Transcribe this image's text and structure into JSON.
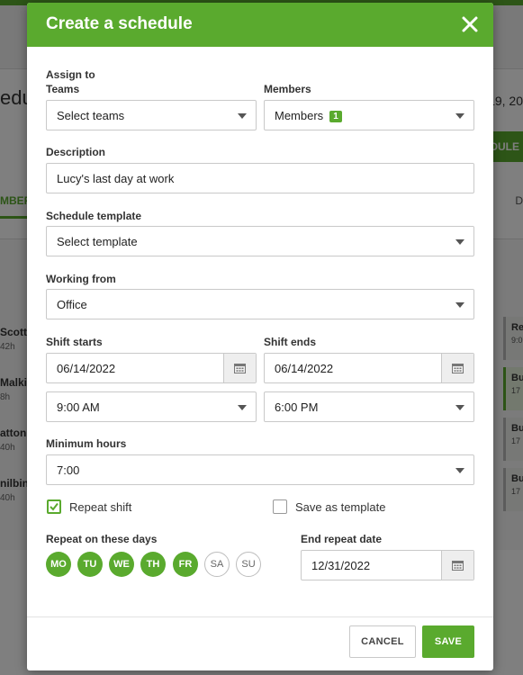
{
  "background": {
    "title_fragment": "edu",
    "date_fragment": "19, 20",
    "button_fragment": "DULE",
    "tab_fragment": "MBER",
    "tab2_fragment": "D",
    "people": [
      {
        "name": "Scott",
        "hours": "42h"
      },
      {
        "name": "Malkin",
        "hours": "8h"
      },
      {
        "name": "atton",
        "hours": "40h"
      },
      {
        "name": "nilbin",
        "hours": "40h"
      }
    ],
    "shifts": [
      {
        "label": "Re",
        "sub": "9:0"
      },
      {
        "label": "Bu",
        "sub": "17"
      },
      {
        "label": "Bu",
        "sub": "17"
      },
      {
        "label": "Bu",
        "sub": "17"
      }
    ]
  },
  "modal": {
    "title": "Create a schedule",
    "assign_to_label": "Assign to",
    "teams": {
      "label": "Teams",
      "value": "Select teams"
    },
    "members": {
      "label": "Members",
      "value": "Members",
      "count": "1"
    },
    "description": {
      "label": "Description",
      "value": "Lucy's last day at work"
    },
    "schedule_template": {
      "label": "Schedule template",
      "value": "Select template"
    },
    "working_from": {
      "label": "Working from",
      "value": "Office"
    },
    "shift_starts": {
      "label": "Shift starts",
      "date": "06/14/2022",
      "time": "9:00 AM"
    },
    "shift_ends": {
      "label": "Shift ends",
      "date": "06/14/2022",
      "time": "6:00 PM"
    },
    "minimum_hours": {
      "label": "Minimum hours",
      "value": "7:00"
    },
    "repeat_shift": {
      "label": "Repeat shift",
      "checked": true
    },
    "save_as_template": {
      "label": "Save as template",
      "checked": false
    },
    "repeat_days": {
      "label": "Repeat on these days",
      "days": [
        {
          "abbr": "MO",
          "selected": true
        },
        {
          "abbr": "TU",
          "selected": true
        },
        {
          "abbr": "WE",
          "selected": true
        },
        {
          "abbr": "TH",
          "selected": true
        },
        {
          "abbr": "FR",
          "selected": true
        },
        {
          "abbr": "SA",
          "selected": false
        },
        {
          "abbr": "SU",
          "selected": false
        }
      ]
    },
    "end_repeat": {
      "label": "End repeat date",
      "value": "12/31/2022"
    },
    "cancel_label": "CANCEL",
    "save_label": "SAVE"
  },
  "colors": {
    "accent": "#5aaa2e",
    "overlay": "rgba(0,0,0,0.5)"
  },
  "icons": [
    "close-icon",
    "calendar-icon",
    "chevron-down-icon",
    "checkmark-icon"
  ]
}
